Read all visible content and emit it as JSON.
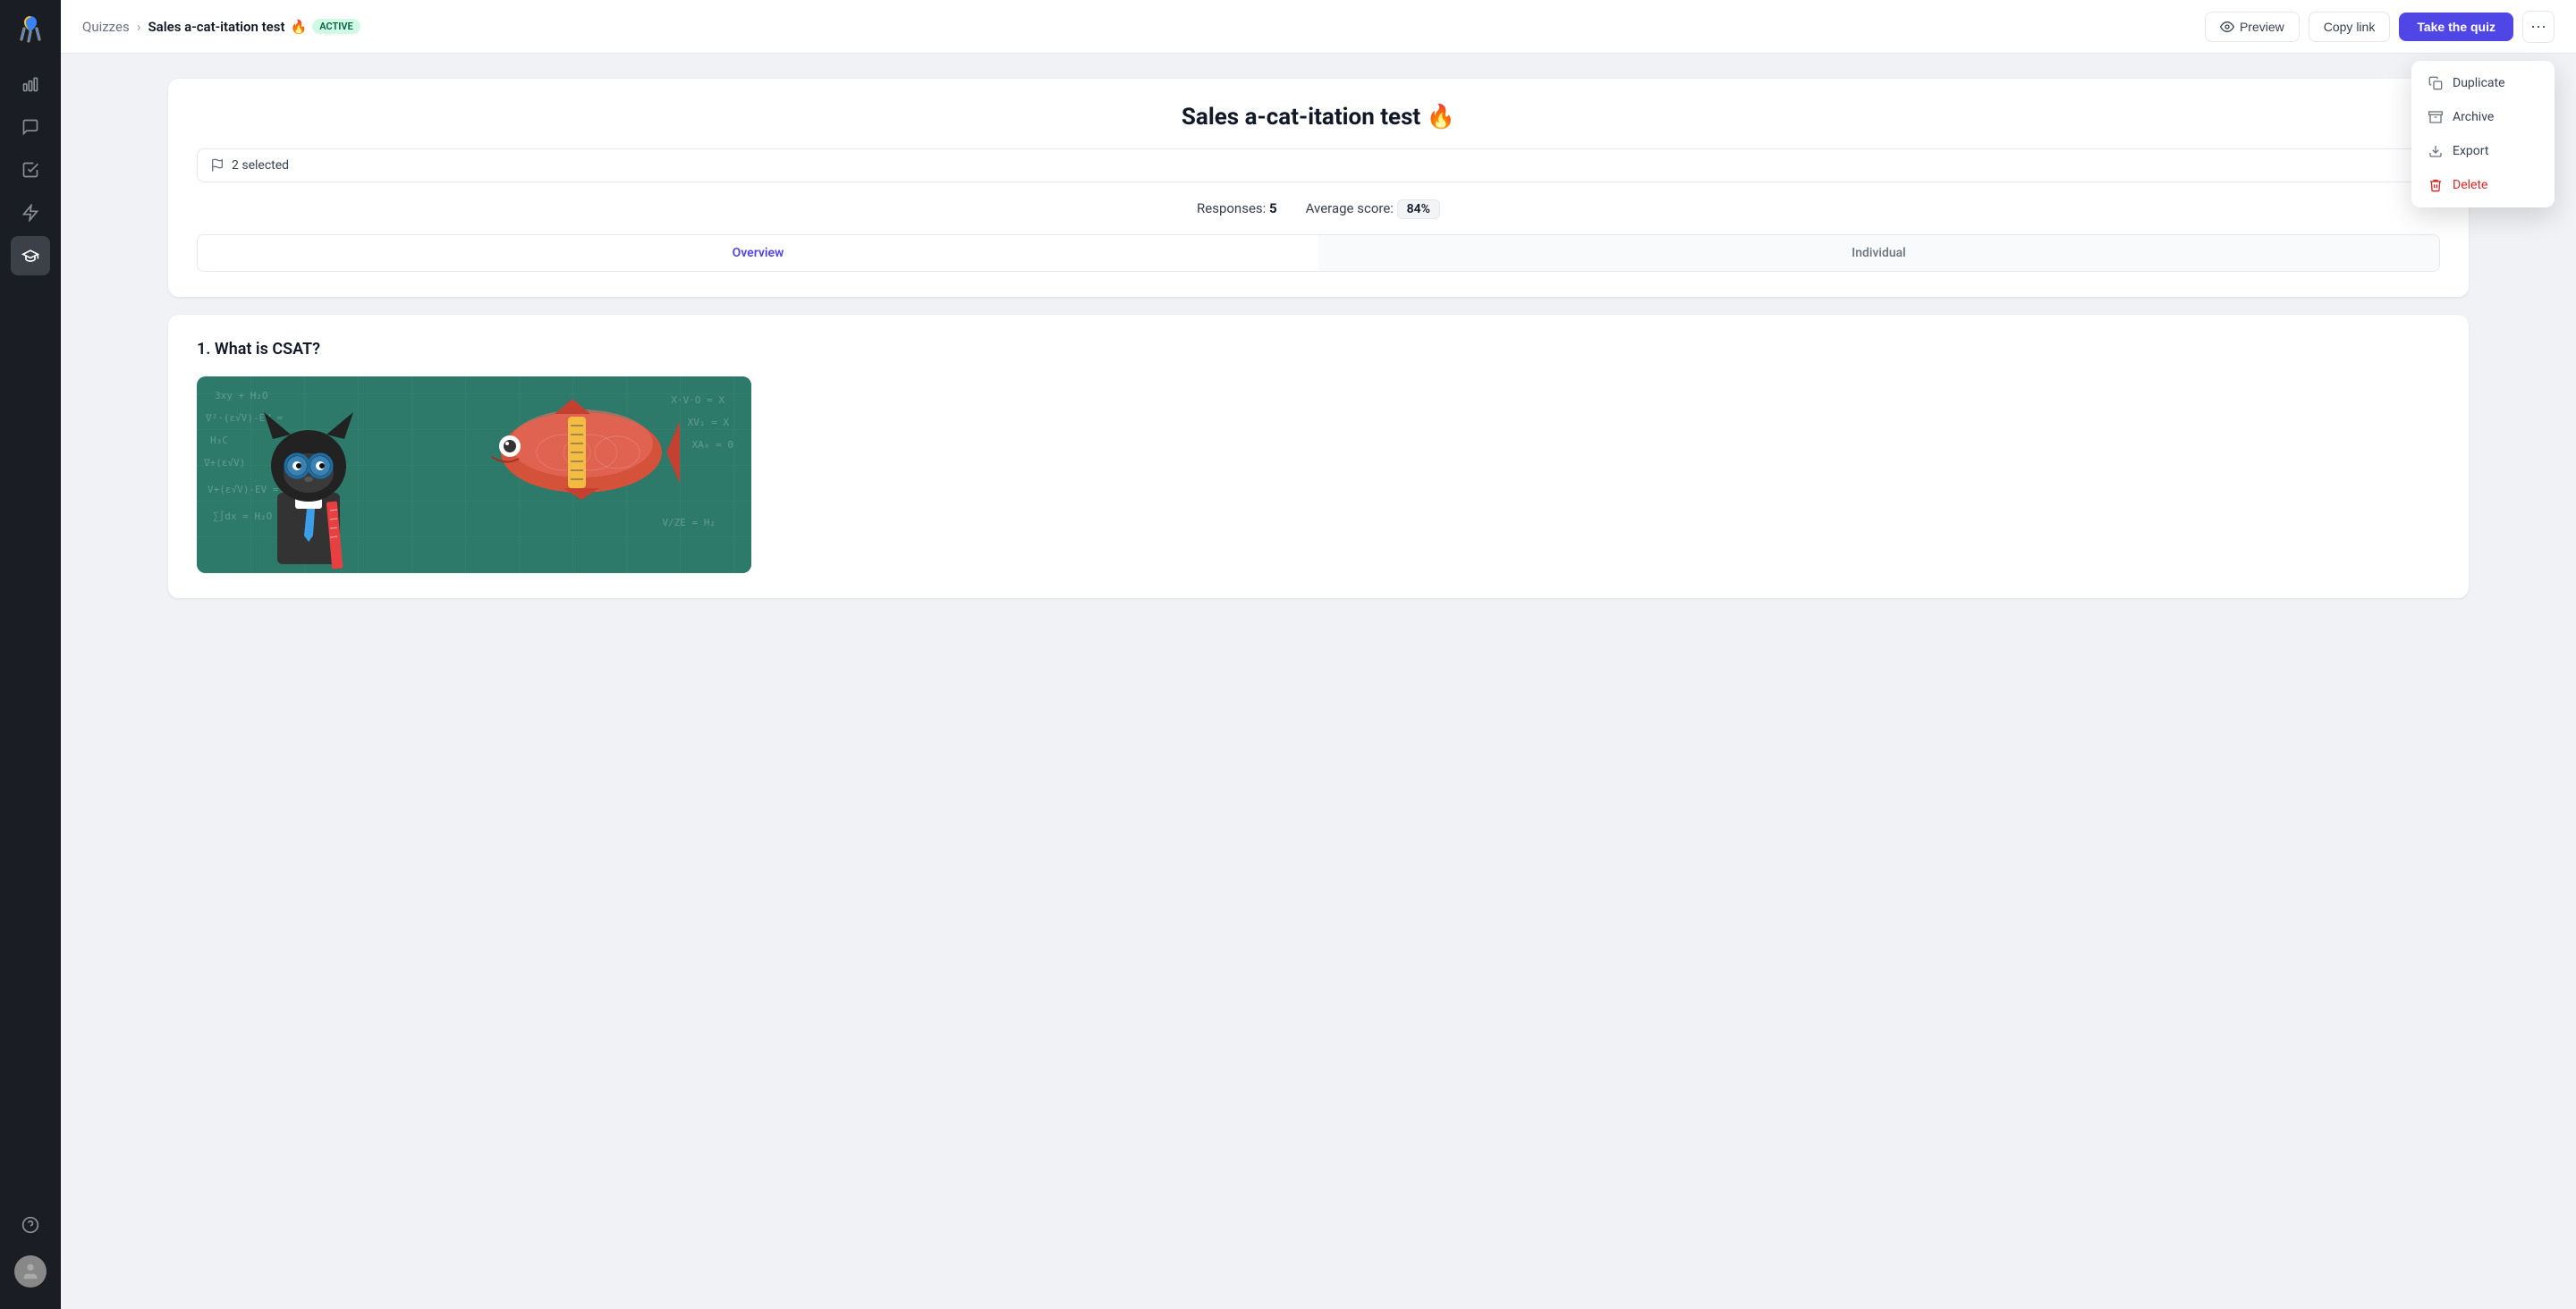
{
  "sidebar": {
    "items": [
      {
        "id": "analytics",
        "icon": "bar-chart",
        "active": false
      },
      {
        "id": "chat",
        "icon": "message",
        "active": false
      },
      {
        "id": "tasks",
        "icon": "check-square",
        "active": false
      },
      {
        "id": "bolt",
        "icon": "bolt",
        "active": false
      },
      {
        "id": "learn",
        "icon": "graduation-cap",
        "active": true
      }
    ],
    "bottom": [
      {
        "id": "help",
        "icon": "question-circle"
      },
      {
        "id": "avatar",
        "icon": "user"
      }
    ]
  },
  "header": {
    "breadcrumb_parent": "Quizzes",
    "breadcrumb_current": "Sales a-cat-itation test",
    "flame_emoji": "🔥",
    "badge_label": "Active",
    "preview_label": "Preview",
    "copy_link_label": "Copy link",
    "take_quiz_label": "Take the quiz"
  },
  "dropdown_menu": {
    "items": [
      {
        "id": "duplicate",
        "label": "Duplicate",
        "icon": "copy"
      },
      {
        "id": "archive",
        "label": "Archive",
        "icon": "archive"
      },
      {
        "id": "export",
        "label": "Export",
        "icon": "download"
      },
      {
        "id": "delete",
        "label": "Delete",
        "icon": "trash",
        "danger": true
      }
    ]
  },
  "quiz_card": {
    "title": "Sales a-cat-itation test",
    "flame_emoji": "🔥",
    "filter_label": "2 selected",
    "responses_label": "Responses:",
    "responses_count": "5",
    "avg_score_label": "Average score:",
    "avg_score_value": "84%",
    "tab_overview": "Overview",
    "tab_individual": "Individual"
  },
  "question": {
    "number": "1",
    "text": "What is CSAT?"
  }
}
